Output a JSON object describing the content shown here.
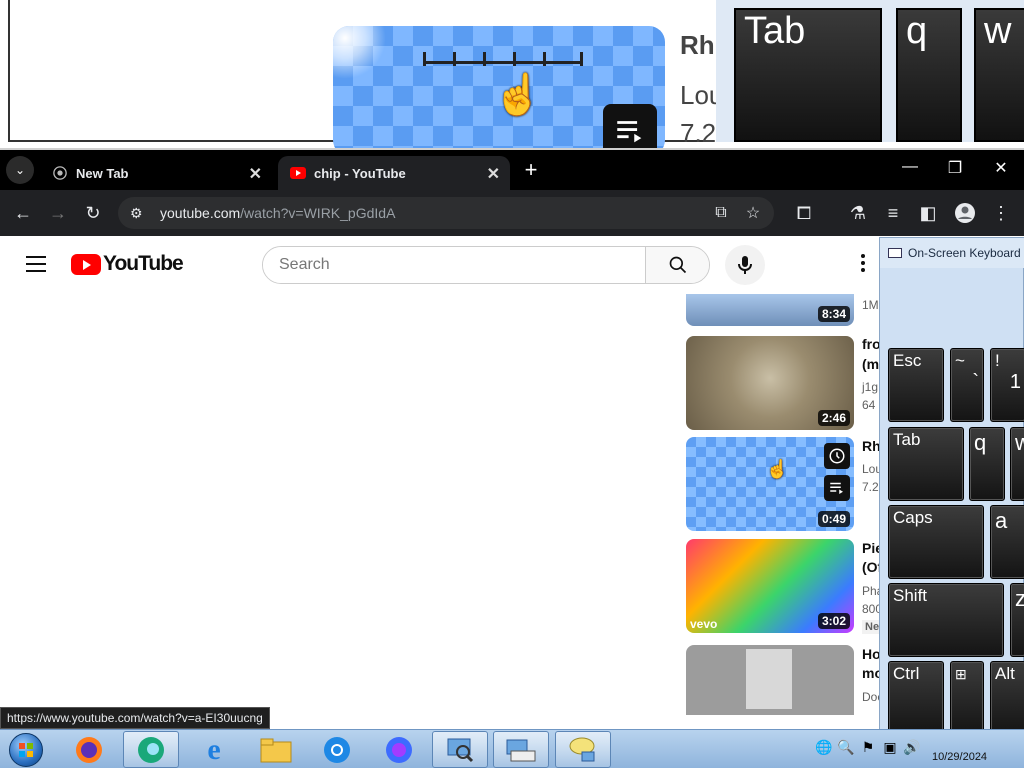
{
  "magnifier": {
    "text_lines": [
      "Rh",
      "Lou",
      "7.2"
    ],
    "keys": [
      "Tab",
      "q",
      "w"
    ]
  },
  "browser": {
    "tabs": [
      {
        "title": "New Tab"
      },
      {
        "title": "chip - YouTube"
      }
    ],
    "url_host": "youtube.com",
    "url_path": "/watch?v=WIRK_pGdIdA"
  },
  "youtube": {
    "logo_text": "YouTube",
    "search_placeholder": "Search",
    "related": [
      {
        "duration": "8:34",
        "title": "",
        "line1": "1M",
        "line2": ""
      },
      {
        "duration": "2:46",
        "title": "fro",
        "title2": "(m",
        "line1": "j1g",
        "line2": "64"
      },
      {
        "duration": "0:49",
        "title": "Rh",
        "line1": "Lou",
        "line2": "7.2"
      },
      {
        "duration": "3:02",
        "title": "Pie",
        "title2": "(Of",
        "line1": "Pha",
        "line2": "800",
        "badge": "Ne",
        "thumb_watermark": "vevo"
      },
      {
        "duration": "",
        "title": "Ho",
        "title2": "mo",
        "line1": "Doc"
      }
    ]
  },
  "status_url": "https://www.youtube.com/watch?v=a-EI30uucng",
  "osk": {
    "title": "On-Screen Keyboard",
    "keys": [
      {
        "label": "Esc"
      },
      {
        "label": "~",
        "sub": "`"
      },
      {
        "label": "!",
        "sub": "1"
      },
      {
        "label": "Tab"
      },
      {
        "label": "q"
      },
      {
        "label": "w"
      },
      {
        "label": "Caps"
      },
      {
        "label": "a"
      },
      {
        "label": "Shift"
      },
      {
        "label": "z"
      },
      {
        "label": "Ctrl"
      },
      {
        "label": "Alt"
      }
    ]
  },
  "taskbar": {
    "date": "10/29/2024"
  },
  "colors": {
    "yt_red": "#ff0000",
    "chrome_dark": "#202124",
    "taskbar": "#b8d3ee"
  }
}
